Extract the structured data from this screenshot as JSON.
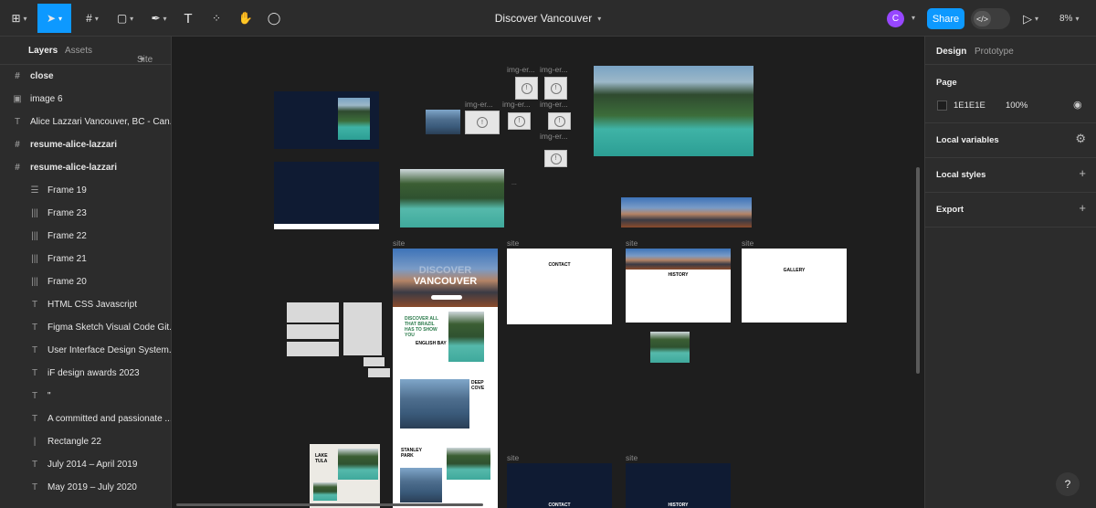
{
  "toolbar": {
    "title": "Discover Vancouver",
    "avatar_initial": "C",
    "share_label": "Share",
    "dev_icon": "</>",
    "zoom": "8%"
  },
  "left_panel": {
    "tabs": [
      "Layers",
      "Assets"
    ],
    "page_selector": "Site",
    "layers": [
      {
        "icon": "#",
        "name": "close",
        "bold": true
      },
      {
        "icon": "▣",
        "name": "image 6",
        "bold": false
      },
      {
        "icon": "T",
        "name": "Alice Lazzari Vancouver, BC - Can...",
        "bold": false
      },
      {
        "icon": "#",
        "name": "resume-alice-lazzari",
        "bold": true
      },
      {
        "icon": "#",
        "name": "resume-alice-lazzari",
        "bold": true
      },
      {
        "icon": "☰",
        "name": "Frame 19",
        "bold": false,
        "indent": true
      },
      {
        "icon": "|||",
        "name": "Frame 23",
        "bold": false,
        "indent": true
      },
      {
        "icon": "|||",
        "name": "Frame 22",
        "bold": false,
        "indent": true
      },
      {
        "icon": "|||",
        "name": "Frame 21",
        "bold": false,
        "indent": true
      },
      {
        "icon": "|||",
        "name": "Frame 20",
        "bold": false,
        "indent": true
      },
      {
        "icon": "T",
        "name": "HTML CSS Javascript",
        "bold": false,
        "indent": true
      },
      {
        "icon": "T",
        "name": "Figma Sketch Visual Code Git...",
        "bold": false,
        "indent": true
      },
      {
        "icon": "T",
        "name": "User Interface Design System...",
        "bold": false,
        "indent": true
      },
      {
        "icon": "T",
        "name": "iF design awards 2023",
        "bold": false,
        "indent": true
      },
      {
        "icon": "T",
        "name": "\"",
        "bold": false,
        "indent": true
      },
      {
        "icon": "T",
        "name": "A committed and passionate ...",
        "bold": false,
        "indent": true
      },
      {
        "icon": "|",
        "name": "Rectangle 22",
        "bold": false,
        "indent": true
      },
      {
        "icon": "T",
        "name": "July 2014 – April 2019",
        "bold": false,
        "indent": true
      },
      {
        "icon": "T",
        "name": "May 2019 – July 2020",
        "bold": false,
        "indent": true
      }
    ]
  },
  "right_panel": {
    "tabs": [
      "Design",
      "Prototype"
    ],
    "page_label": "Page",
    "page_color": "1E1E1E",
    "page_opacity": "100%",
    "sections": [
      "Local variables",
      "Local styles",
      "Export"
    ]
  },
  "canvas": {
    "frame_label": "site",
    "img_err": "img-er...",
    "dots": "...",
    "hero_discover": "DISCOVER",
    "hero_vancouver": "VANCOUVER",
    "discover_all": "DISCOVER ALL THAT BRAZIL HAS TO SHOW YOU",
    "english_bay": "ENGLISH BAY",
    "deep_cove": "DEEP COVE",
    "stanley_park": "STANLEY PARK",
    "lake_tula": "LAKE TULA",
    "contact": "CONTACT",
    "history": "HISTORY",
    "gallery": "GALLERY"
  },
  "help": "?"
}
